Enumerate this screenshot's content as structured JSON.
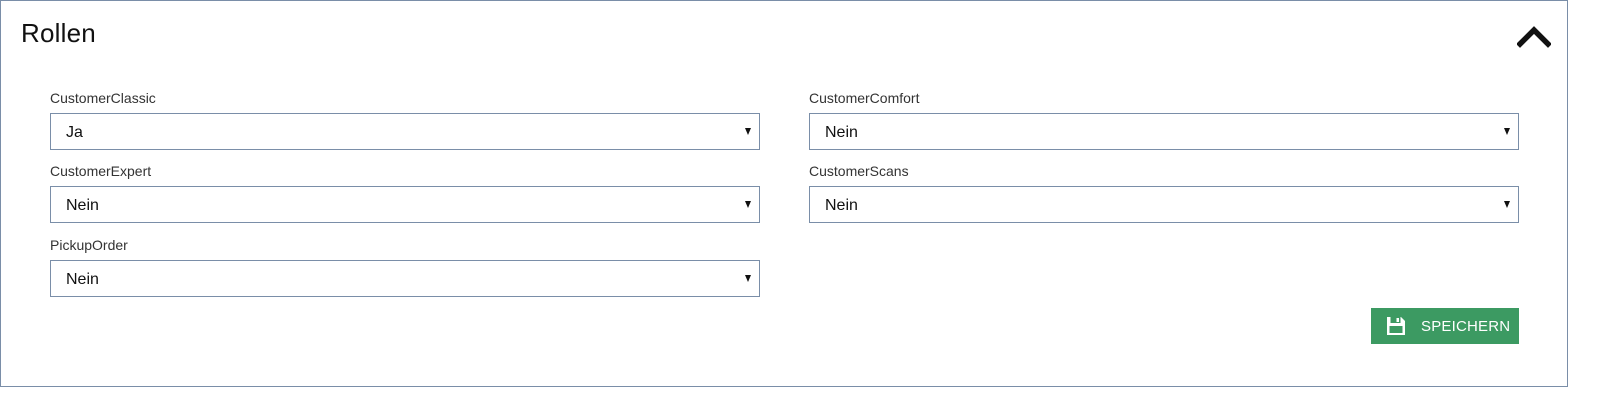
{
  "panel": {
    "title": "Rollen",
    "collapse_icon": "chevron-up-icon"
  },
  "fields": [
    {
      "label": "CustomerClassic",
      "value": "Ja"
    },
    {
      "label": "CustomerComfort",
      "value": "Nein"
    },
    {
      "label": "CustomerExpert",
      "value": "Nein"
    },
    {
      "label": "CustomerScans",
      "value": "Nein"
    },
    {
      "label": "PickupOrder",
      "value": "Nein"
    }
  ],
  "actions": {
    "save_label": "SPEICHERN",
    "save_icon": "floppy-disk-icon",
    "save_color": "#3c9a62"
  },
  "colors": {
    "border": "#7a8ea8"
  }
}
